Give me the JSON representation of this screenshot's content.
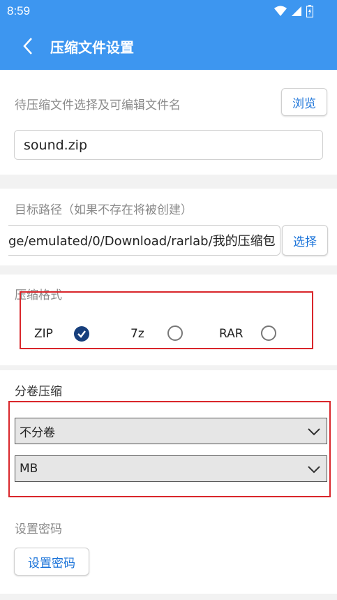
{
  "status_bar": {
    "time": "8:59",
    "icons": [
      "wifi-icon",
      "signal-icon",
      "battery-icon"
    ]
  },
  "app_bar": {
    "title": "压缩文件设置",
    "back_icon": "chevron-left-icon"
  },
  "file_section": {
    "label": "待压缩文件选择及可编辑文件名",
    "browse_button": "浏览",
    "filename_value": "sound.zip"
  },
  "target_section": {
    "label": "目标路径（如果不存在将被创建）",
    "path_value": "ge/emulated/0/Download/rarlab/我的压缩包",
    "select_button": "选择"
  },
  "format_section": {
    "label": "压缩格式",
    "options": [
      {
        "label": "ZIP",
        "selected": true
      },
      {
        "label": "7z",
        "selected": false
      },
      {
        "label": "RAR",
        "selected": false
      }
    ]
  },
  "volume_section": {
    "label": "分卷压缩",
    "volume_select": "不分卷",
    "unit_select": "MB"
  },
  "password_section": {
    "label": "设置密码",
    "button": "设置密码"
  },
  "colors": {
    "accent": "#3d96f0",
    "link": "#1a73d9",
    "highlight": "#d9262b",
    "radio_checked": "#173f7c"
  }
}
